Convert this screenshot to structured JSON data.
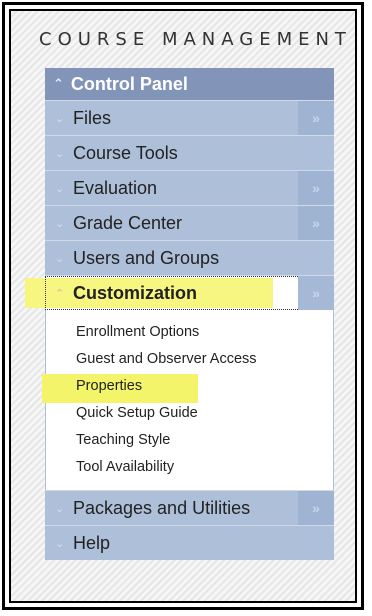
{
  "heading": "COURSE MANAGEMENT",
  "control_panel": {
    "label": "Control Panel",
    "icon": "chevron-up-icon"
  },
  "items": {
    "files": "Files",
    "course_tools": "Course Tools",
    "evaluation": "Evaluation",
    "grade_center": "Grade Center",
    "users_groups": "Users and Groups",
    "customization": "Customization",
    "packages": "Packages and Utilities",
    "help": "Help"
  },
  "submenu": {
    "enrollment": "Enrollment Options",
    "guest": "Guest and Observer Access",
    "properties": "Properties",
    "quick_setup": "Quick Setup Guide",
    "teaching_style": "Teaching Style",
    "tool_availability": "Tool Availability"
  },
  "glyphs": {
    "collapsed": "≫",
    "expand": "»",
    "open": "≪"
  },
  "colors": {
    "header": "#8294b7",
    "item": "#aebfd9",
    "highlight": "#f4f46a"
  }
}
